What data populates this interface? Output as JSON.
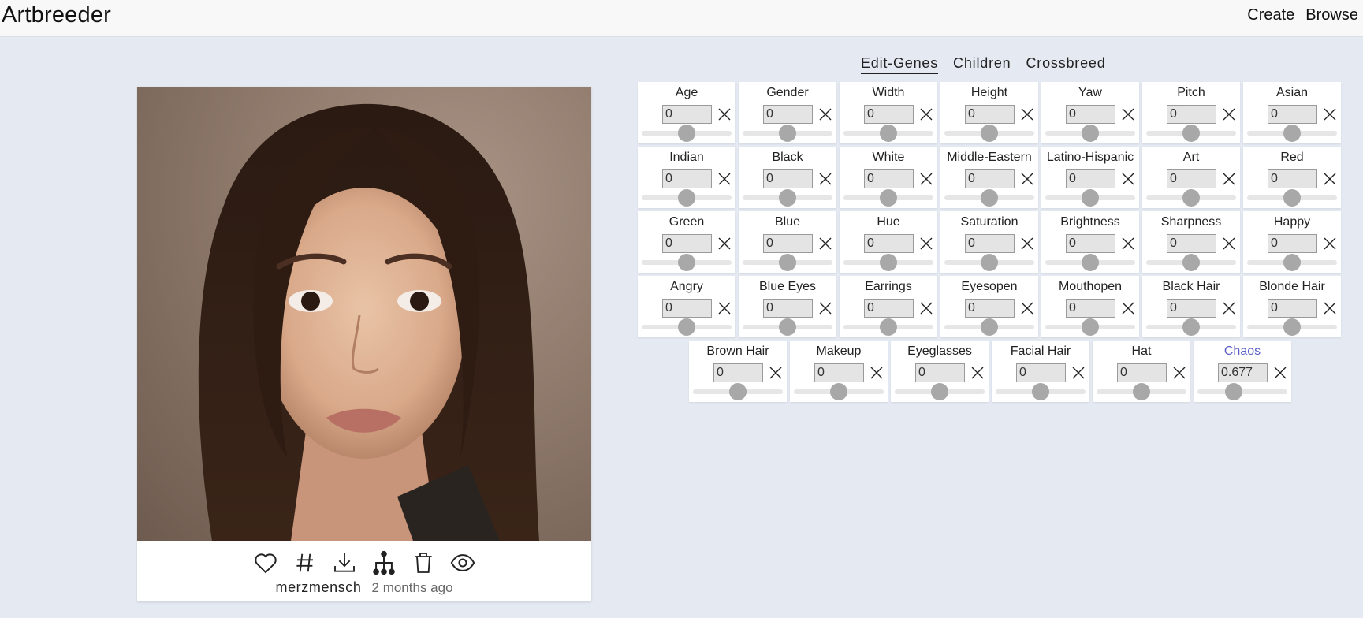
{
  "header": {
    "brand": "Artbreeder",
    "nav": [
      "Create",
      "Browse"
    ]
  },
  "card": {
    "user": "merzmensch",
    "time_ago": "2 months ago",
    "actions": [
      "heart-icon",
      "hash-icon",
      "download-icon",
      "family-tree-icon",
      "trash-icon",
      "eye-icon"
    ]
  },
  "tabs": [
    "Edit-Genes",
    "Children",
    "Crossbreed"
  ],
  "active_tab": 0,
  "accent_color": "#5b5fc7",
  "genes": [
    [
      {
        "name": "Age",
        "value": "0"
      },
      {
        "name": "Gender",
        "value": "0"
      },
      {
        "name": "Width",
        "value": "0"
      },
      {
        "name": "Height",
        "value": "0"
      },
      {
        "name": "Yaw",
        "value": "0"
      },
      {
        "name": "Pitch",
        "value": "0"
      },
      {
        "name": "Asian",
        "value": "0"
      }
    ],
    [
      {
        "name": "Indian",
        "value": "0"
      },
      {
        "name": "Black",
        "value": "0"
      },
      {
        "name": "White",
        "value": "0"
      },
      {
        "name": "Middle-Eastern",
        "value": "0"
      },
      {
        "name": "Latino-Hispanic",
        "value": "0"
      },
      {
        "name": "Art",
        "value": "0"
      },
      {
        "name": "Red",
        "value": "0"
      }
    ],
    [
      {
        "name": "Green",
        "value": "0"
      },
      {
        "name": "Blue",
        "value": "0"
      },
      {
        "name": "Hue",
        "value": "0"
      },
      {
        "name": "Saturation",
        "value": "0"
      },
      {
        "name": "Brightness",
        "value": "0"
      },
      {
        "name": "Sharpness",
        "value": "0"
      },
      {
        "name": "Happy",
        "value": "0"
      }
    ],
    [
      {
        "name": "Angry",
        "value": "0"
      },
      {
        "name": "Blue Eyes",
        "value": "0"
      },
      {
        "name": "Earrings",
        "value": "0"
      },
      {
        "name": "Eyesopen",
        "value": "0"
      },
      {
        "name": "Mouthopen",
        "value": "0"
      },
      {
        "name": "Black Hair",
        "value": "0"
      },
      {
        "name": "Blonde Hair",
        "value": "0"
      }
    ],
    [
      {
        "name": "Brown Hair",
        "value": "0"
      },
      {
        "name": "Makeup",
        "value": "0"
      },
      {
        "name": "Eyeglasses",
        "value": "0"
      },
      {
        "name": "Facial Hair",
        "value": "0"
      },
      {
        "name": "Hat",
        "value": "0"
      },
      {
        "name": "Chaos",
        "value": "0.677",
        "highlight": true
      }
    ]
  ]
}
